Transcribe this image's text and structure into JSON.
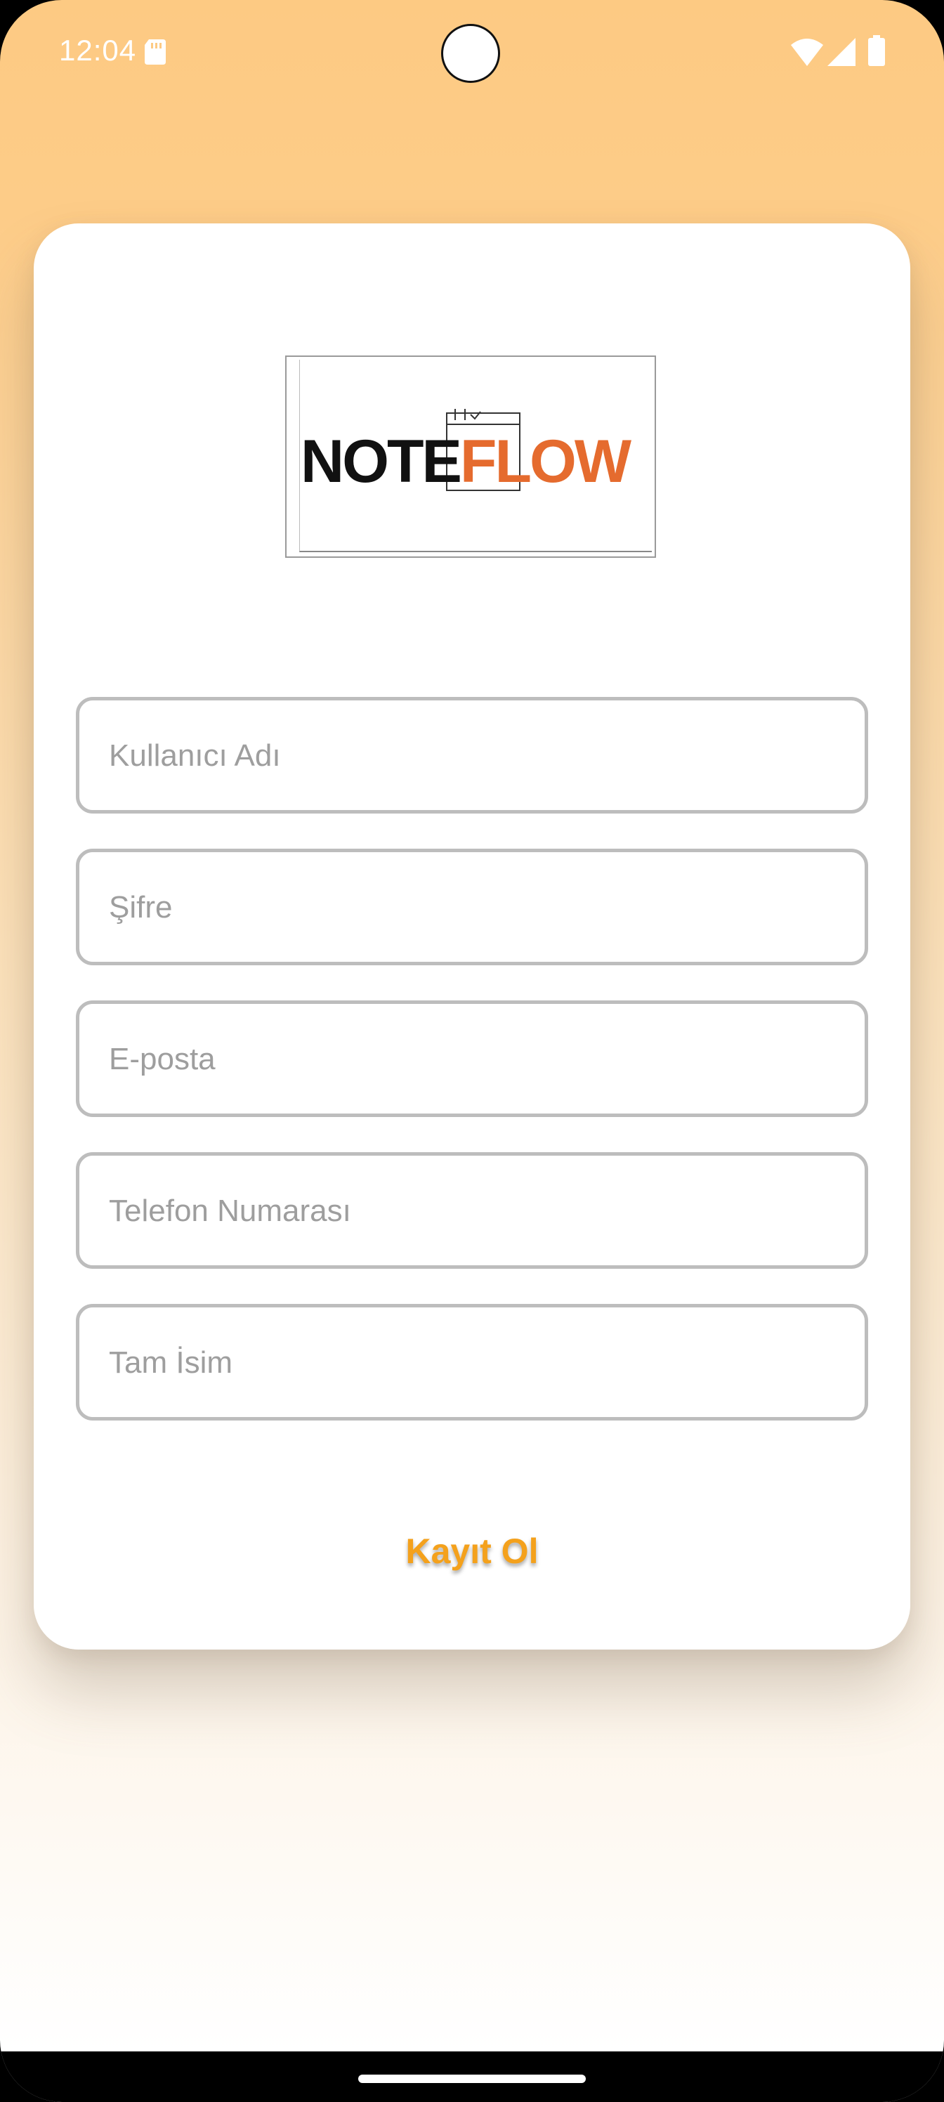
{
  "status_bar": {
    "time": "12:04",
    "icons": [
      "sd-card-icon",
      "wifi-icon",
      "signal-icon",
      "battery-icon"
    ]
  },
  "logo": {
    "part1": "NOTE",
    "part2": "FLOW",
    "colors": {
      "note": "#111111",
      "flow": "#e56b2e"
    }
  },
  "form": {
    "username_placeholder": "Kullanıcı Adı",
    "password_placeholder": "Şifre",
    "email_placeholder": "E-posta",
    "phone_placeholder": "Telefon Numarası",
    "fullname_placeholder": "Tam İsim"
  },
  "actions": {
    "register_label": "Kayıt Ol"
  },
  "colors": {
    "accent": "#f4a11c",
    "background_top": "#fdca83",
    "field_border": "#bdbdbd"
  }
}
